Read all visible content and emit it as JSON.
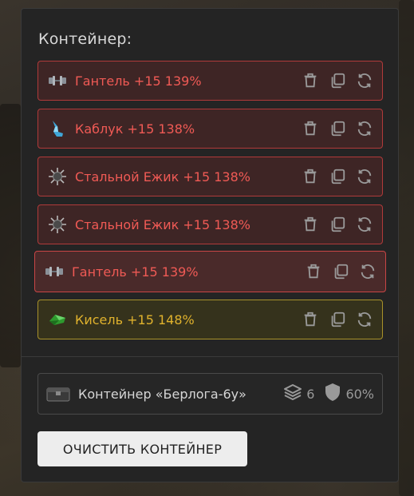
{
  "panel": {
    "title": "Контейнер:"
  },
  "items": [
    {
      "label": "Гантель +15 139%",
      "rarity": "red",
      "icon": "dumbbell-icon"
    },
    {
      "label": "Каблук +15 138%",
      "rarity": "red",
      "icon": "crystal-heel-icon"
    },
    {
      "label": "Стальной Ежик +15 138%",
      "rarity": "red",
      "icon": "spiky-ball-icon"
    },
    {
      "label": "Стальной Ежик +15 138%",
      "rarity": "red",
      "icon": "spiky-ball-icon"
    },
    {
      "label": "Гантель +15 139%",
      "rarity": "red",
      "icon": "dumbbell-icon"
    },
    {
      "label": "Кисель +15 148%",
      "rarity": "yellow",
      "icon": "jelly-icon"
    }
  ],
  "item_actions": [
    "trash-icon",
    "copy-icon",
    "refresh-icon"
  ],
  "container": {
    "name": "Контейнер «Берлога-6у»",
    "slots": "6",
    "protection": "60%",
    "icon": "chest-icon"
  },
  "clear_button": "ОЧИСТИТЬ КОНТЕЙНЕР",
  "colors": {
    "red_text": "#f05a55",
    "red_border": "#b03a3a",
    "yellow_text": "#e0b22d",
    "yellow_border": "#a8912a",
    "panel_bg": "#242424"
  }
}
